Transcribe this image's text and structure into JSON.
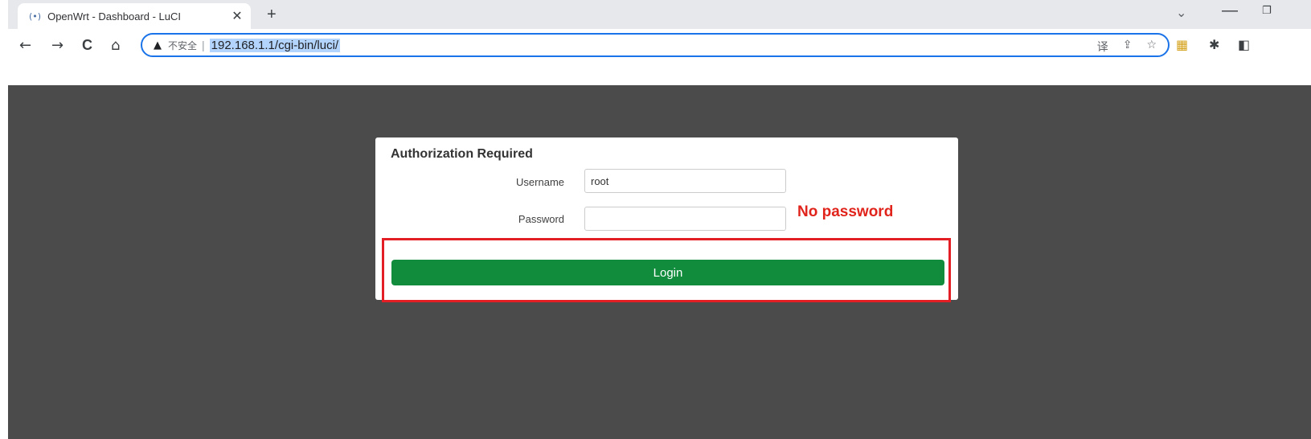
{
  "browser": {
    "tab": {
      "favicon": "(•)",
      "title": "OpenWrt - Dashboard - LuCI",
      "close": "✕"
    },
    "new_tab": "+",
    "tab_search": "⌄",
    "window_minimize": "—",
    "window_restore": "❐",
    "toolbar": {
      "back": "←",
      "forward": "→",
      "reload": "C",
      "home": "⌂",
      "security_warning": "▲",
      "security_text": "不安全",
      "separator": "|",
      "url": "192.168.1.1/cgi-bin/luci/",
      "translate_icon": "译",
      "share_icon": "⇪",
      "bookmark_icon": "☆",
      "extension_icon": "▦",
      "puzzle_icon": "✱",
      "sidepanel_icon": "◧"
    }
  },
  "login": {
    "title": "Authorization Required",
    "username_label": "Username",
    "username_value": "root",
    "password_label": "Password",
    "password_value": "",
    "login_button": "Login"
  },
  "annotation": {
    "note": "No password",
    "color": "#e31e24"
  },
  "colors": {
    "page_background": "#4b4b4b",
    "login_button": "#118b3c",
    "url_highlight": "#b3d4fc",
    "omnibox_border": "#1a73e8"
  }
}
